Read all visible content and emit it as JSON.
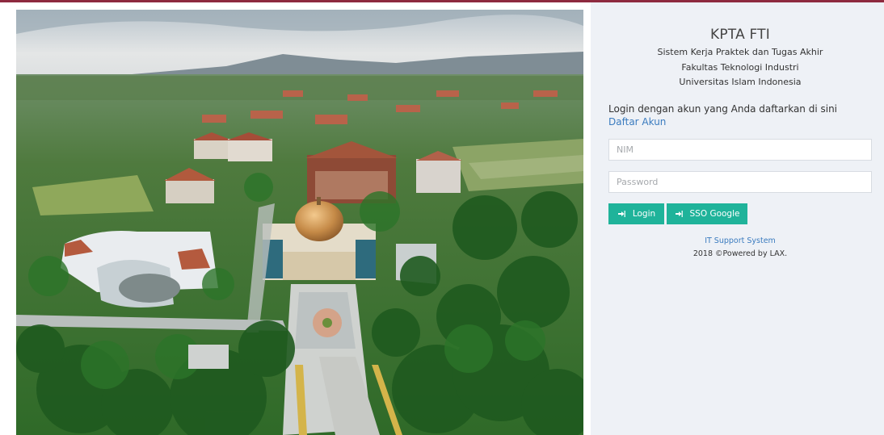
{
  "app": {
    "title": "KPTA FTI",
    "subtitle_lines": [
      "Sistem Kerja Praktek dan Tugas Akhir",
      "Fakultas Teknologi Industri",
      "Universitas Islam Indonesia"
    ]
  },
  "login": {
    "instruction": "Login dengan akun yang Anda daftarkan di sini",
    "register_link": "Daftar Akun",
    "nim_placeholder": "NIM",
    "password_placeholder": "Password",
    "login_button": "Login",
    "sso_button": "SSO Google"
  },
  "footer": {
    "support_link": "IT Support System",
    "powered": "2018 ©Powered by LAX."
  },
  "colors": {
    "accent": "#1fb39a",
    "link": "#3a7bbf",
    "top_border": "#8e2a3f",
    "panel_bg": "#eef1f6"
  },
  "icons": {
    "login_button_icon": "sign-in-icon",
    "sso_button_icon": "sign-in-icon"
  }
}
